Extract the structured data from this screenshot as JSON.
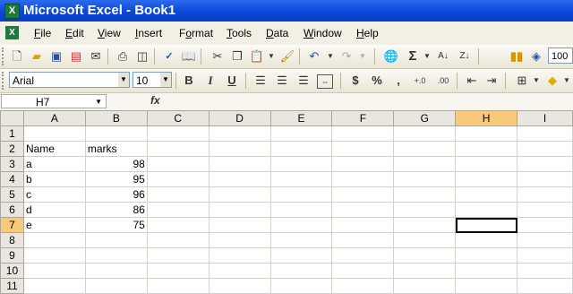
{
  "window": {
    "app_icon": "X",
    "title": "Microsoft Excel - Book1"
  },
  "menu": {
    "items": [
      {
        "key": "F",
        "rest": "ile"
      },
      {
        "key": "E",
        "rest": "dit"
      },
      {
        "key": "V",
        "rest": "iew"
      },
      {
        "key": "I",
        "rest": "nsert"
      },
      {
        "key": "",
        "pre": "F",
        "key2": "o",
        "rest": "rmat"
      },
      {
        "key": "T",
        "rest": "ools"
      },
      {
        "key": "D",
        "rest": "ata"
      },
      {
        "key": "W",
        "rest": "indow"
      },
      {
        "key": "H",
        "rest": "elp"
      }
    ]
  },
  "formatting": {
    "font": "Arial",
    "size": "10",
    "bold": "B",
    "italic": "I",
    "underline": "U",
    "currency": "$",
    "percent": "%",
    "comma": ",",
    "inc_decimal": "+.0",
    "dec_decimal": ".00",
    "zoom": "100"
  },
  "formula_bar": {
    "name_box": "H7",
    "fx": "fx",
    "formula": ""
  },
  "sheet": {
    "columns": [
      "A",
      "B",
      "C",
      "D",
      "E",
      "F",
      "G",
      "H",
      "I"
    ],
    "active_cell": "H7",
    "rows": [
      {
        "n": "1",
        "a": "",
        "b": ""
      },
      {
        "n": "2",
        "a": "Name",
        "b": "marks"
      },
      {
        "n": "3",
        "a": "a",
        "b": "98"
      },
      {
        "n": "4",
        "a": "b",
        "b": "95"
      },
      {
        "n": "5",
        "a": "c",
        "b": "96"
      },
      {
        "n": "6",
        "a": "d",
        "b": "86"
      },
      {
        "n": "7",
        "a": "e",
        "b": "75"
      },
      {
        "n": "8",
        "a": "",
        "b": ""
      },
      {
        "n": "9",
        "a": "",
        "b": ""
      },
      {
        "n": "10",
        "a": "",
        "b": ""
      },
      {
        "n": "11",
        "a": "",
        "b": ""
      }
    ]
  },
  "icons": [
    "new-icon",
    "open-icon",
    "save-icon",
    "permission-icon",
    "email-icon",
    "print-icon",
    "print-preview-icon",
    "spelling-icon",
    "research-icon",
    "cut-icon",
    "copy-icon",
    "paste-icon",
    "format-painter-icon",
    "undo-icon",
    "redo-icon",
    "hyperlink-icon",
    "autosum-icon",
    "sort-ascending-icon",
    "sort-descending-icon",
    "chart-wizard-icon",
    "drawing-icon",
    "borders-icon",
    "fill-color-icon",
    "arrow-down-annotation"
  ]
}
